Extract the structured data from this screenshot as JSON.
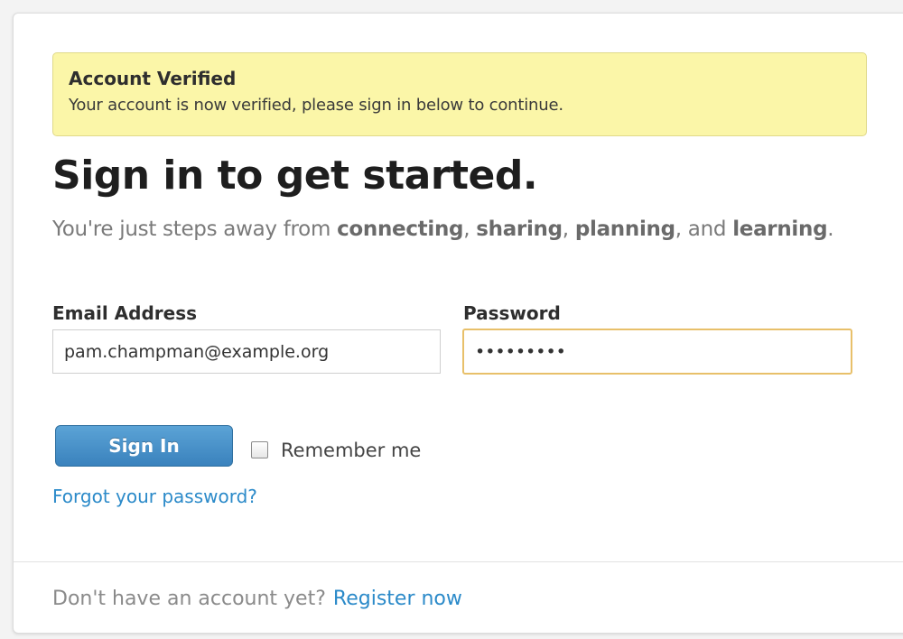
{
  "alert": {
    "title": "Account Verified",
    "message": "Your account is now verified, please sign in below to continue."
  },
  "heading": "Sign in to get started.",
  "subheading": {
    "prefix": "You're just steps away from ",
    "word1": "connecting",
    "sep1": ", ",
    "word2": "sharing",
    "sep2": ", ",
    "word3": "planning",
    "sep3": ", and ",
    "word4": "learning",
    "suffix": "."
  },
  "form": {
    "email_label": "Email Address",
    "email_value": "pam.champman@example.org",
    "password_label": "Password",
    "password_value": "password1",
    "signin_label": "Sign In",
    "remember_label": "Remember me",
    "remember_checked": false,
    "forgot_link": "Forgot your password?"
  },
  "footer": {
    "text": "Don't have an account yet?",
    "register_link": "Register now"
  },
  "colors": {
    "alert_bg": "#fbf6a8",
    "button_blue": "#3a82bd",
    "link_blue": "#2b8ac9",
    "focus_border": "#e8c06a"
  }
}
